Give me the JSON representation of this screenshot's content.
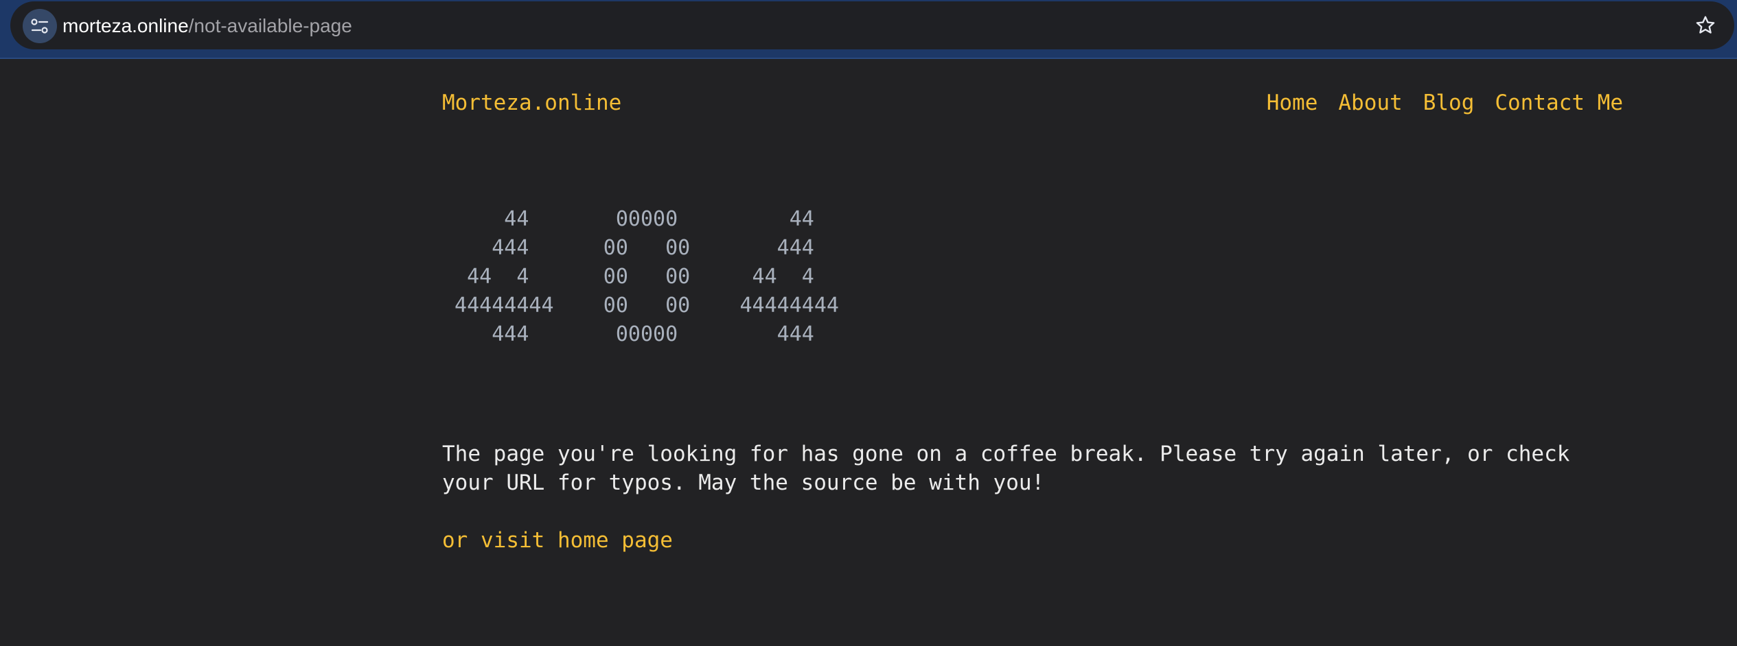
{
  "browser": {
    "url_host": "morteza.online",
    "url_path": "/not-available-page"
  },
  "header": {
    "brand": "Morteza.online",
    "nav": [
      "Home",
      "About",
      "Blog",
      "Contact Me"
    ]
  },
  "main": {
    "ascii_404": "     44       00000         44\n    444      00   00       444\n  44  4      00   00     44  4\n 44444444    00   00    44444444\n    444       00000        444",
    "message": "The page you're looking for has gone on a coffee break. Please try again later, or check your URL for typos. May the source be with you!",
    "home_link": "or visit home page"
  },
  "colors": {
    "accent": "#f5be35",
    "background": "#222224",
    "ascii": "#a9b1bd",
    "text": "#ececec"
  }
}
